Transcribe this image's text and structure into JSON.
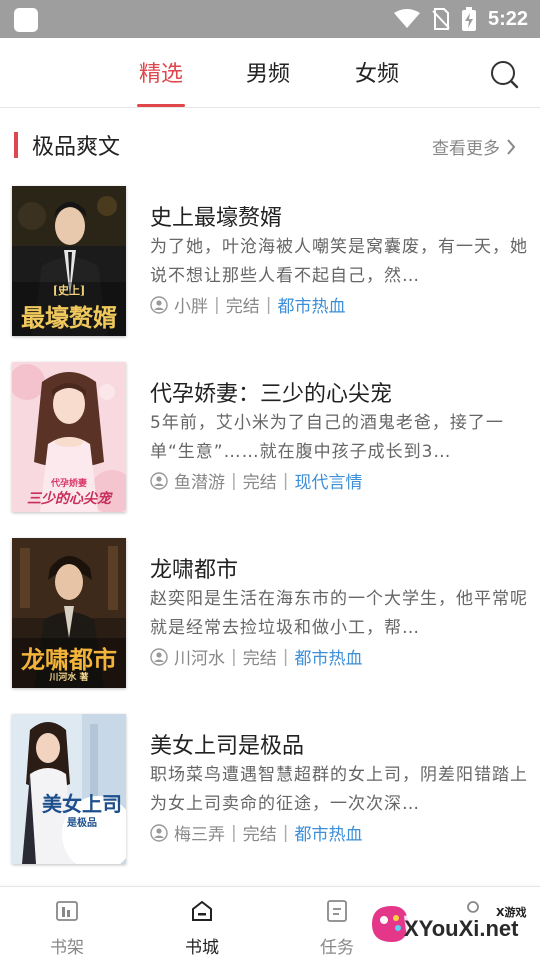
{
  "status_bar": {
    "time": "5:22"
  },
  "tabs": [
    {
      "label": "精选",
      "active": true
    },
    {
      "label": "男频",
      "active": false
    },
    {
      "label": "女频",
      "active": false
    }
  ],
  "section": {
    "title": "极品爽文",
    "more_label": "查看更多"
  },
  "books": [
    {
      "title": "史上最壕赘婿",
      "desc": "为了她，叶沧海被人嘲笑是窝囊废，有一天，她说不想让那些人看不起自己，然…",
      "author": "小胖",
      "status": "完结",
      "genre": "都市热血",
      "cover_text": "最壕赘婿",
      "cover_subtext": "[史上]"
    },
    {
      "title": "代孕娇妻：三少的心尖宠",
      "desc": "5年前，艾小米为了自己的酒鬼老爸，接了一单“生意”……就在腹中孩子成长到3…",
      "author": "鱼潜游",
      "status": "完结",
      "genre": "现代言情",
      "cover_text": "三少的心尖宠",
      "cover_subtext": "代孕娇妻"
    },
    {
      "title": "龙啸都市",
      "desc": "赵奕阳是生活在海东市的一个大学生，他平常呢就是经常去捡垃圾和做小工，帮…",
      "author": "川河水",
      "status": "完结",
      "genre": "都市热血",
      "cover_text": "龙啸都市",
      "cover_subtext": "川河水 著"
    },
    {
      "title": "美女上司是极品",
      "desc": "职场菜鸟遭遇智慧超群的女上司，阴差阳错踏上为女上司卖命的征途，一次次深…",
      "author": "梅三弄",
      "status": "完结",
      "genre": "都市热血",
      "cover_text": "美女上司",
      "cover_subtext": "是极品"
    }
  ],
  "bottom_nav": [
    {
      "label": "书架",
      "icon": "bookshelf-icon",
      "active": false
    },
    {
      "label": "书城",
      "icon": "bookstore-icon",
      "active": true
    },
    {
      "label": "任务",
      "icon": "task-icon",
      "active": false
    }
  ],
  "watermark": {
    "small": "X游戏",
    "big": "XYouXi.net"
  },
  "colors": {
    "accent": "#e0474d",
    "genre": "#3d8fd8",
    "status_bar": "#9e9e9e"
  }
}
